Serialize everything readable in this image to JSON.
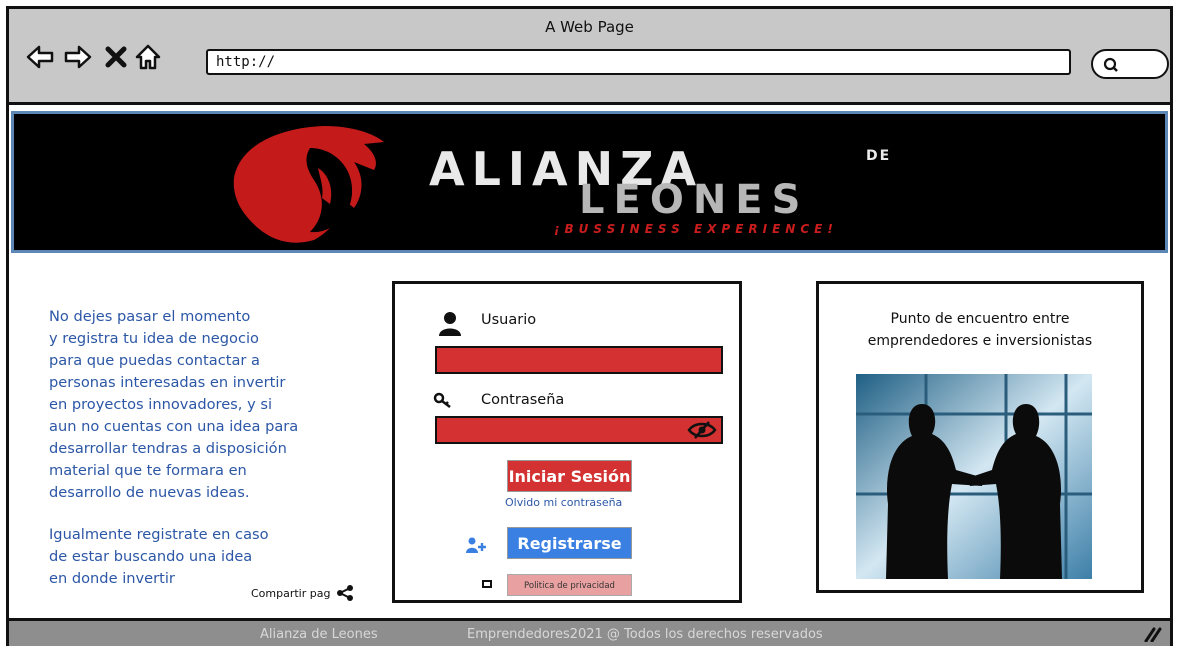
{
  "window": {
    "title": "A Web Page"
  },
  "address_bar": {
    "url": "http://"
  },
  "banner": {
    "brand_line1": "ALIANZA",
    "brand_de": "DE",
    "brand_line2": "LEONES",
    "tagline": "¡BUSSINESS EXPERIENCE!"
  },
  "intro": {
    "paragraph1": "No dejes pasar el momento\ny registra tu idea de negocio\npara que puedas contactar a\npersonas interesadas en invertir\nen proyectos innovadores, y si\naun no cuentas con una idea para\ndesarrollar tendras a disposición\nmaterial que te formara en\ndesarrollo de nuevas ideas.",
    "paragraph2": "Igualmente registrate en caso\nde estar buscando una idea\nen donde invertir",
    "share_label": "Compartir pag"
  },
  "login": {
    "user_label": "Usuario",
    "password_label": "Contraseña",
    "login_button": "Iniciar Sesión",
    "forgot_link": "Olvido mi contraseña",
    "register_button": "Registrarse",
    "privacy_button": "Politica de privacidad"
  },
  "aside": {
    "heading": "Punto de encuentro entre\nemprendedores e inversionistas"
  },
  "footer": {
    "brand": "Alianza de Leones",
    "copyright": "Emprendedores2021 @  Todos los derechos reservados"
  },
  "colors": {
    "link_blue": "#2c57a6",
    "login_red": "#d43232",
    "register_blue": "#3a80e3",
    "privacy_pink": "#e8a0a0",
    "banner_border": "#5d88b6",
    "footer_gray": "#8e8e8e"
  },
  "icons": [
    "back-arrow-icon",
    "forward-arrow-icon",
    "stop-icon",
    "home-icon",
    "search-icon",
    "user-icon",
    "key-icon",
    "eye-slash-icon",
    "add-user-icon",
    "privacy-icon",
    "share-icon",
    "resize-grip-icon"
  ]
}
